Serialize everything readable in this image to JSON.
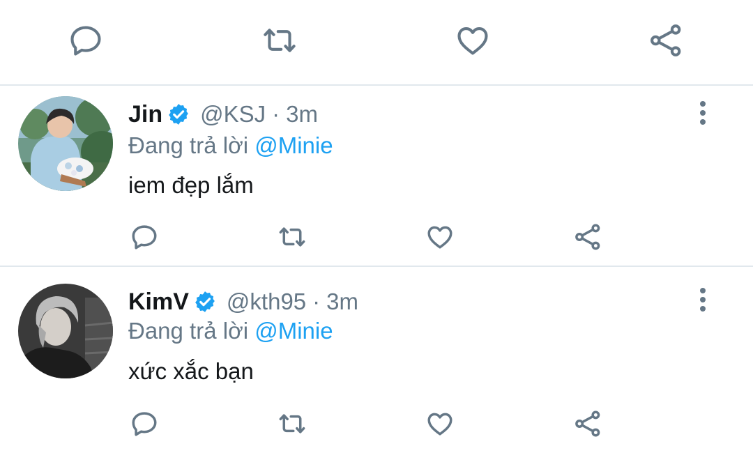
{
  "colors": {
    "icon_gray": "#657786",
    "link_blue": "#1da1f2",
    "verified_blue": "#1da1f2",
    "divider": "#e1e8ed",
    "text_dark": "#14171a"
  },
  "top_actions": {
    "icons": [
      "reply-icon",
      "retweet-icon",
      "like-icon",
      "share-icon"
    ]
  },
  "replies": [
    {
      "display_name": "Jin",
      "verified": true,
      "handle": "@KSJ",
      "separator": "·",
      "time": "3m",
      "replying_prefix": "Đang trả lời",
      "replying_to": "@Minie",
      "text": "iem đẹp lắm",
      "avatar": "avatar-photo-jin"
    },
    {
      "display_name": "KimV",
      "verified": true,
      "handle": "@kth95",
      "separator": "·",
      "time": "3m",
      "replying_prefix": "Đang trả lời",
      "replying_to": "@Minie",
      "text": "xức xắc bạn",
      "avatar": "avatar-photo-kimv"
    }
  ]
}
